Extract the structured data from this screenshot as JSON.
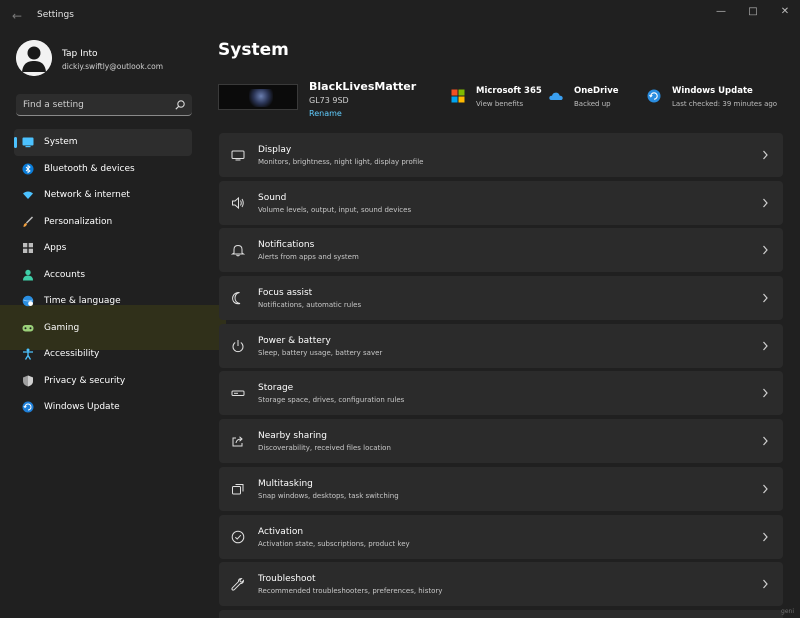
{
  "window": {
    "title": "Settings",
    "controls": [
      "minimize",
      "maximize",
      "close"
    ]
  },
  "profile": {
    "name": "Tap Into",
    "email": "dickiy.swiftly@outlook.com"
  },
  "search": {
    "placeholder": "Find a setting"
  },
  "sidebar": {
    "items": [
      {
        "label": "System",
        "icon": "monitor-icon",
        "active": true
      },
      {
        "label": "Bluetooth & devices",
        "icon": "bluetooth-icon"
      },
      {
        "label": "Network & internet",
        "icon": "wifi-icon"
      },
      {
        "label": "Personalization",
        "icon": "brush-icon"
      },
      {
        "label": "Apps",
        "icon": "apps-icon"
      },
      {
        "label": "Accounts",
        "icon": "person-icon"
      },
      {
        "label": "Time & language",
        "icon": "globe-clock-icon"
      },
      {
        "label": "Gaming",
        "icon": "gamepad-icon"
      },
      {
        "label": "Accessibility",
        "icon": "accessibility-icon"
      },
      {
        "label": "Privacy & security",
        "icon": "shield-icon"
      },
      {
        "label": "Windows Update",
        "icon": "refresh-icon"
      }
    ]
  },
  "main": {
    "title": "System",
    "device": {
      "name": "BlackLivesMatter",
      "model": "GL73 9SD",
      "rename_label": "Rename"
    },
    "quick_links": [
      {
        "title": "Microsoft 365",
        "subtitle": "View benefits",
        "icon": "microsoft-logo-icon"
      },
      {
        "title": "OneDrive",
        "subtitle": "Backed up",
        "icon": "onedrive-cloud-icon"
      },
      {
        "title": "Windows Update",
        "subtitle": "Last checked: 39 minutes ago",
        "icon": "windows-update-icon"
      }
    ],
    "cards": [
      {
        "title": "Display",
        "subtitle": "Monitors, brightness, night light, display profile",
        "icon": "display-icon"
      },
      {
        "title": "Sound",
        "subtitle": "Volume levels, output, input, sound devices",
        "icon": "speaker-icon"
      },
      {
        "title": "Notifications",
        "subtitle": "Alerts from apps and system",
        "icon": "bell-icon"
      },
      {
        "title": "Focus assist",
        "subtitle": "Notifications, automatic rules",
        "icon": "moon-icon"
      },
      {
        "title": "Power & battery",
        "subtitle": "Sleep, battery usage, battery saver",
        "icon": "power-icon"
      },
      {
        "title": "Storage",
        "subtitle": "Storage space, drives, configuration rules",
        "icon": "storage-icon"
      },
      {
        "title": "Nearby sharing",
        "subtitle": "Discoverability, received files location",
        "icon": "share-icon"
      },
      {
        "title": "Multitasking",
        "subtitle": "Snap windows, desktops, task switching",
        "icon": "multitasking-icon"
      },
      {
        "title": "Activation",
        "subtitle": "Activation state, subscriptions, product key",
        "icon": "check-circle-icon"
      },
      {
        "title": "Troubleshoot",
        "subtitle": "Recommended troubleshooters, preferences, history",
        "icon": "wrench-icon"
      }
    ]
  },
  "watermark": "geni",
  "colors": {
    "background": "#202020",
    "card": "#2b2b2b",
    "accent": "#4cc2ff",
    "link": "#60cdff"
  }
}
